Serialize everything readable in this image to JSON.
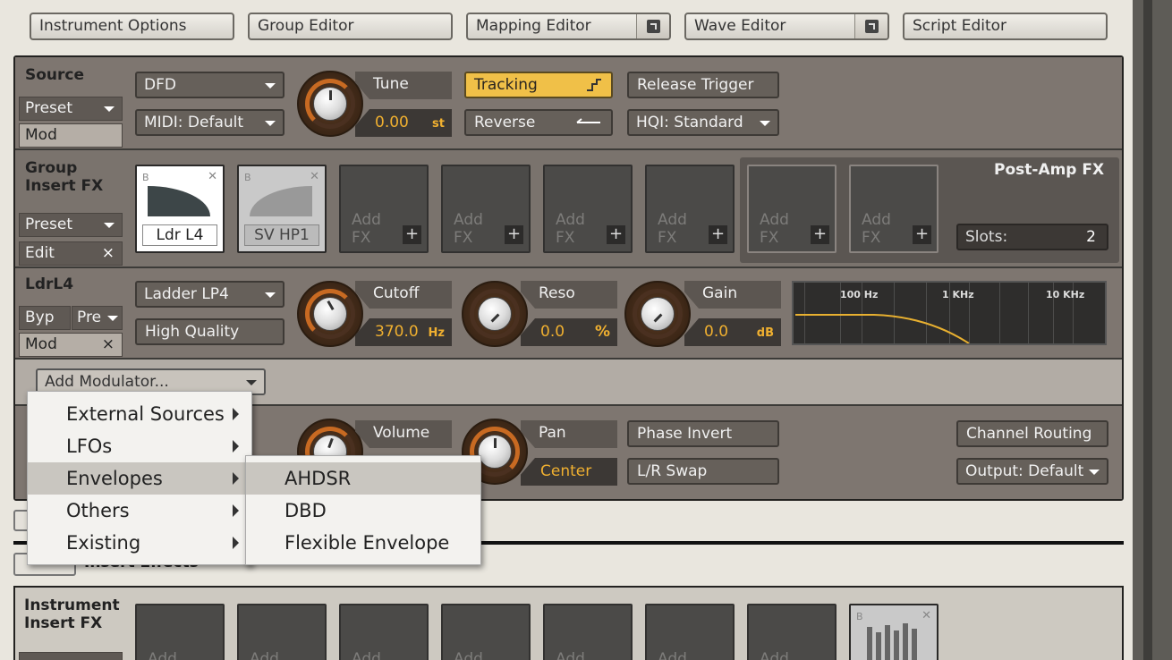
{
  "top_tabs": {
    "instrument_options": "Instrument Options",
    "group_editor": "Group Editor",
    "mapping_editor": "Mapping Editor",
    "wave_editor": "Wave Editor",
    "script_editor": "Script Editor"
  },
  "source": {
    "title": "Source",
    "preset": "Preset",
    "mod": "Mod",
    "mode": "DFD",
    "midi": "MIDI: Default",
    "tune_label": "Tune",
    "tune_value": "0.00",
    "tune_unit": "st",
    "tracking": "Tracking",
    "reverse": "Reverse",
    "release_trigger": "Release Trigger",
    "hqi": "HQI: Standard"
  },
  "group_fx": {
    "title_line1": "Group",
    "title_line2": "Insert FX",
    "preset": "Preset",
    "edit": "Edit",
    "slots": [
      {
        "name": "Ldr L4"
      },
      {
        "name": "SV HP1"
      }
    ],
    "add_fx_line1": "Add",
    "add_fx_line2": "FX",
    "post_amp": "Post-Amp FX",
    "slots_label": "Slots:",
    "slots_value": "2"
  },
  "filter": {
    "title": "LdrL4",
    "byp": "Byp",
    "pre": "Pre",
    "mod": "Mod",
    "type": "Ladder LP4",
    "quality": "High Quality",
    "cutoff_label": "Cutoff",
    "cutoff_value": "370.0",
    "cutoff_unit": "Hz",
    "reso_label": "Reso",
    "reso_value": "0.0",
    "reso_unit": "%",
    "gain_label": "Gain",
    "gain_value": "0.0",
    "gain_unit": "dB",
    "graph_labels": [
      "100 Hz",
      "1 KHz",
      "10 KHz"
    ]
  },
  "add_modulator": "Add Modulator...",
  "amp": {
    "volume_label": "Volume",
    "pan_label": "Pan",
    "pan_value": "Center",
    "phase_invert": "Phase Invert",
    "lr_swap": "L/R Swap",
    "channel_routing": "Channel Routing",
    "output": "Output: Default"
  },
  "insert_effects": "Insert Effects",
  "instrument_fx": {
    "title_line1": "Instrument",
    "title_line2": "Insert FX",
    "add_fx": "Add"
  },
  "menu": {
    "items": [
      "External Sources",
      "LFOs",
      "Envelopes",
      "Others",
      "Existing"
    ],
    "submenu": [
      "AHDSR",
      "DBD",
      "Flexible Envelope"
    ]
  },
  "colors": {
    "accent": "#f0b030",
    "knob_ring": "#c86a22"
  }
}
